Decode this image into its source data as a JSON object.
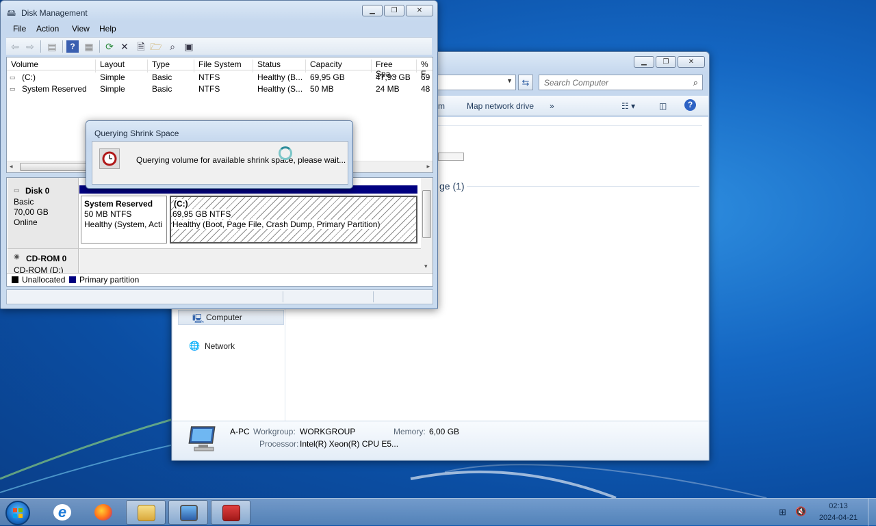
{
  "explorer": {
    "search_placeholder": "Search Computer",
    "cmd_partial": "m",
    "map_network_drive": "Map network drive",
    "more_chevron": "»",
    "storage_partial": "ge (1)",
    "nav": {
      "computer": "Computer",
      "network": "Network"
    },
    "details": {
      "pc_name": "A-PC",
      "workgroup_label": "Workgroup:",
      "workgroup_value": "WORKGROUP",
      "memory_label": "Memory:",
      "memory_value": "6,00 GB",
      "processor_label": "Processor:",
      "processor_value": "Intel(R) Xeon(R) CPU E5..."
    }
  },
  "disk_management": {
    "title": "Disk Management",
    "menu": {
      "file": "File",
      "action": "Action",
      "view": "View",
      "help": "Help"
    },
    "columns": {
      "volume": "Volume",
      "layout": "Layout",
      "type": "Type",
      "file_system": "File System",
      "status": "Status",
      "capacity": "Capacity",
      "free_space": "Free Spa...",
      "pct_free": "% F"
    },
    "volumes": [
      {
        "volume": "(C:)",
        "layout": "Simple",
        "type": "Basic",
        "fs": "NTFS",
        "status": "Healthy (B...",
        "capacity": "69,95 GB",
        "free": "47,93 GB",
        "pct": "69"
      },
      {
        "volume": "System Reserved",
        "layout": "Simple",
        "type": "Basic",
        "fs": "NTFS",
        "status": "Healthy (S...",
        "capacity": "50 MB",
        "free": "24 MB",
        "pct": "48"
      }
    ],
    "disk0": {
      "name": "Disk 0",
      "type": "Basic",
      "size": "70,00 GB",
      "state": "Online",
      "partitions": [
        {
          "name": "System Reserved",
          "size": "50 MB NTFS",
          "status": "Healthy (System, Acti"
        },
        {
          "name": "(C:)",
          "size": "69,95 GB NTFS",
          "status": "Healthy (Boot, Page File, Crash Dump, Primary Partition)"
        }
      ]
    },
    "cdrom0": {
      "name": "CD-ROM 0",
      "drive": "CD-ROM (D:)"
    },
    "legend": {
      "unallocated": "Unallocated",
      "primary": "Primary partition",
      "unallocated_color": "#000000",
      "primary_color": "#000080"
    }
  },
  "query_dialog": {
    "title": "Querying Shrink Space",
    "message": "Querying volume for available shrink space, please wait..."
  },
  "taskbar": {
    "apps": [
      "internet-explorer",
      "firefox",
      "file-explorer",
      "computer-management",
      "toolbox"
    ],
    "time": "02:13",
    "date": "2024-04-21"
  }
}
